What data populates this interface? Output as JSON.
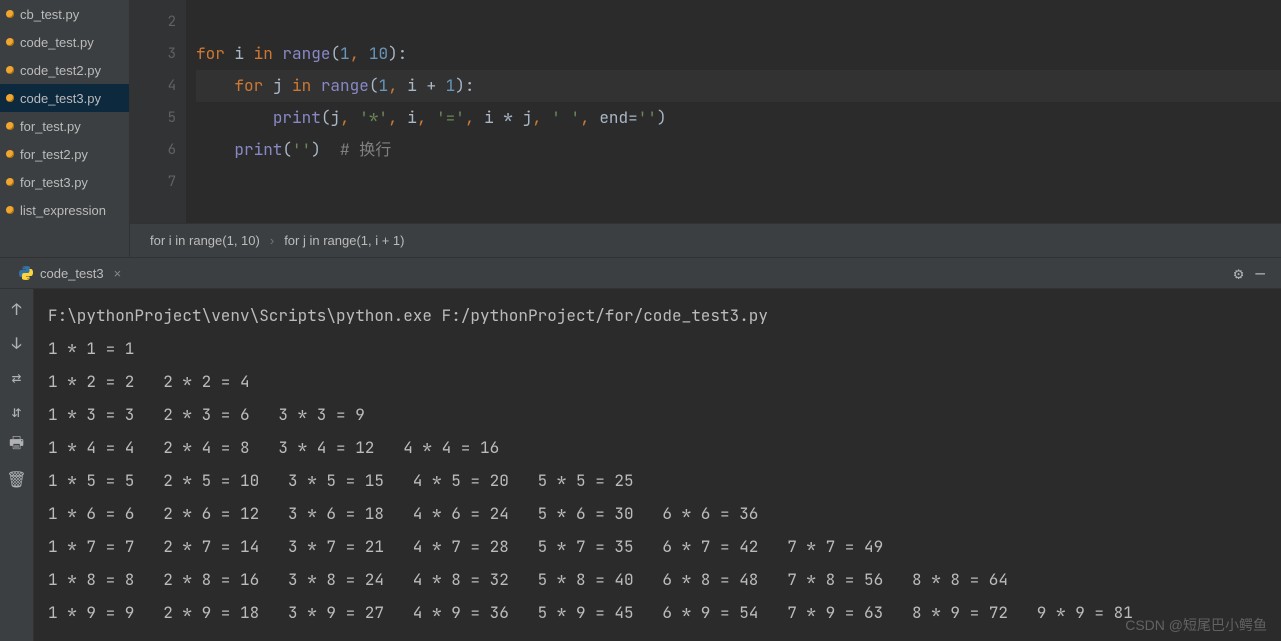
{
  "sidebar": {
    "files": [
      {
        "name": "cb_test.py"
      },
      {
        "name": "code_test.py"
      },
      {
        "name": "code_test2.py"
      },
      {
        "name": "code_test3.py"
      },
      {
        "name": "for_test.py"
      },
      {
        "name": "for_test2.py"
      },
      {
        "name": "for_test3.py"
      },
      {
        "name": "list_expression"
      }
    ],
    "selected_index": 3
  },
  "editor": {
    "line_numbers": [
      "2",
      "3",
      "4",
      "5",
      "6",
      "7"
    ],
    "code_lines": [
      {
        "tokens": [
          {
            "t": "",
            "c": "id"
          }
        ]
      },
      {
        "tokens": [
          {
            "t": "for ",
            "c": "k"
          },
          {
            "t": "i ",
            "c": "id"
          },
          {
            "t": "in ",
            "c": "k"
          },
          {
            "t": "range",
            "c": "fn"
          },
          {
            "t": "(",
            "c": "op"
          },
          {
            "t": "1",
            "c": "n"
          },
          {
            "t": ", ",
            "c": "p"
          },
          {
            "t": "10",
            "c": "n"
          },
          {
            "t": "):",
            "c": "op"
          }
        ]
      },
      {
        "hl": true,
        "tokens": [
          {
            "t": "    ",
            "c": "id"
          },
          {
            "t": "for ",
            "c": "k"
          },
          {
            "t": "j ",
            "c": "id"
          },
          {
            "t": "in ",
            "c": "k"
          },
          {
            "t": "range",
            "c": "fn"
          },
          {
            "t": "(",
            "c": "op"
          },
          {
            "t": "1",
            "c": "n"
          },
          {
            "t": ", ",
            "c": "p"
          },
          {
            "t": "i + ",
            "c": "id"
          },
          {
            "t": "1",
            "c": "n"
          },
          {
            "t": "):",
            "c": "op"
          }
        ]
      },
      {
        "tokens": [
          {
            "t": "        ",
            "c": "id"
          },
          {
            "t": "print",
            "c": "fn"
          },
          {
            "t": "(j",
            "c": "id"
          },
          {
            "t": ", ",
            "c": "p"
          },
          {
            "t": "'*'",
            "c": "s"
          },
          {
            "t": ", ",
            "c": "p"
          },
          {
            "t": "i",
            "c": "id"
          },
          {
            "t": ", ",
            "c": "p"
          },
          {
            "t": "'='",
            "c": "s"
          },
          {
            "t": ", ",
            "c": "p"
          },
          {
            "t": "i * j",
            "c": "id"
          },
          {
            "t": ", ",
            "c": "p"
          },
          {
            "t": "' '",
            "c": "s"
          },
          {
            "t": ", ",
            "c": "p"
          },
          {
            "t": "end",
            "c": "id"
          },
          {
            "t": "=",
            "c": "op"
          },
          {
            "t": "''",
            "c": "s"
          },
          {
            "t": ")",
            "c": "op"
          }
        ]
      },
      {
        "tokens": [
          {
            "t": "    ",
            "c": "id"
          },
          {
            "t": "print",
            "c": "fn"
          },
          {
            "t": "(",
            "c": "op"
          },
          {
            "t": "''",
            "c": "s"
          },
          {
            "t": ")  ",
            "c": "op"
          },
          {
            "t": "# 换行",
            "c": "c"
          }
        ]
      },
      {
        "tokens": [
          {
            "t": "",
            "c": "id"
          }
        ]
      }
    ]
  },
  "breadcrumbs": {
    "items": [
      "for i in range(1, 10)",
      "for j in range(1, i + 1)"
    ],
    "sep": "›"
  },
  "run_tab": {
    "name": "code_test3",
    "close": "×"
  },
  "toolbar_icons": {
    "gear": "⚙",
    "minus": "—"
  },
  "left_tools": [
    "↑",
    "↓",
    "⇄",
    "⇵",
    "🖶",
    "🗑"
  ],
  "console": {
    "lines": [
      "F:\\pythonProject\\venv\\Scripts\\python.exe F:/pythonProject/for/code_test3.py",
      "1 * 1 = 1  ",
      "1 * 2 = 2   2 * 2 = 4  ",
      "1 * 3 = 3   2 * 3 = 6   3 * 3 = 9  ",
      "1 * 4 = 4   2 * 4 = 8   3 * 4 = 12   4 * 4 = 16  ",
      "1 * 5 = 5   2 * 5 = 10   3 * 5 = 15   4 * 5 = 20   5 * 5 = 25  ",
      "1 * 6 = 6   2 * 6 = 12   3 * 6 = 18   4 * 6 = 24   5 * 6 = 30   6 * 6 = 36  ",
      "1 * 7 = 7   2 * 7 = 14   3 * 7 = 21   4 * 7 = 28   5 * 7 = 35   6 * 7 = 42   7 * 7 = 49  ",
      "1 * 8 = 8   2 * 8 = 16   3 * 8 = 24   4 * 8 = 32   5 * 8 = 40   6 * 8 = 48   7 * 8 = 56   8 * 8 = 64  ",
      "1 * 9 = 9   2 * 9 = 18   3 * 9 = 27   4 * 9 = 36   5 * 9 = 45   6 * 9 = 54   7 * 9 = 63   8 * 9 = 72   9 * 9 = 81  "
    ]
  },
  "watermark": "CSDN @短尾巴小鳄鱼"
}
